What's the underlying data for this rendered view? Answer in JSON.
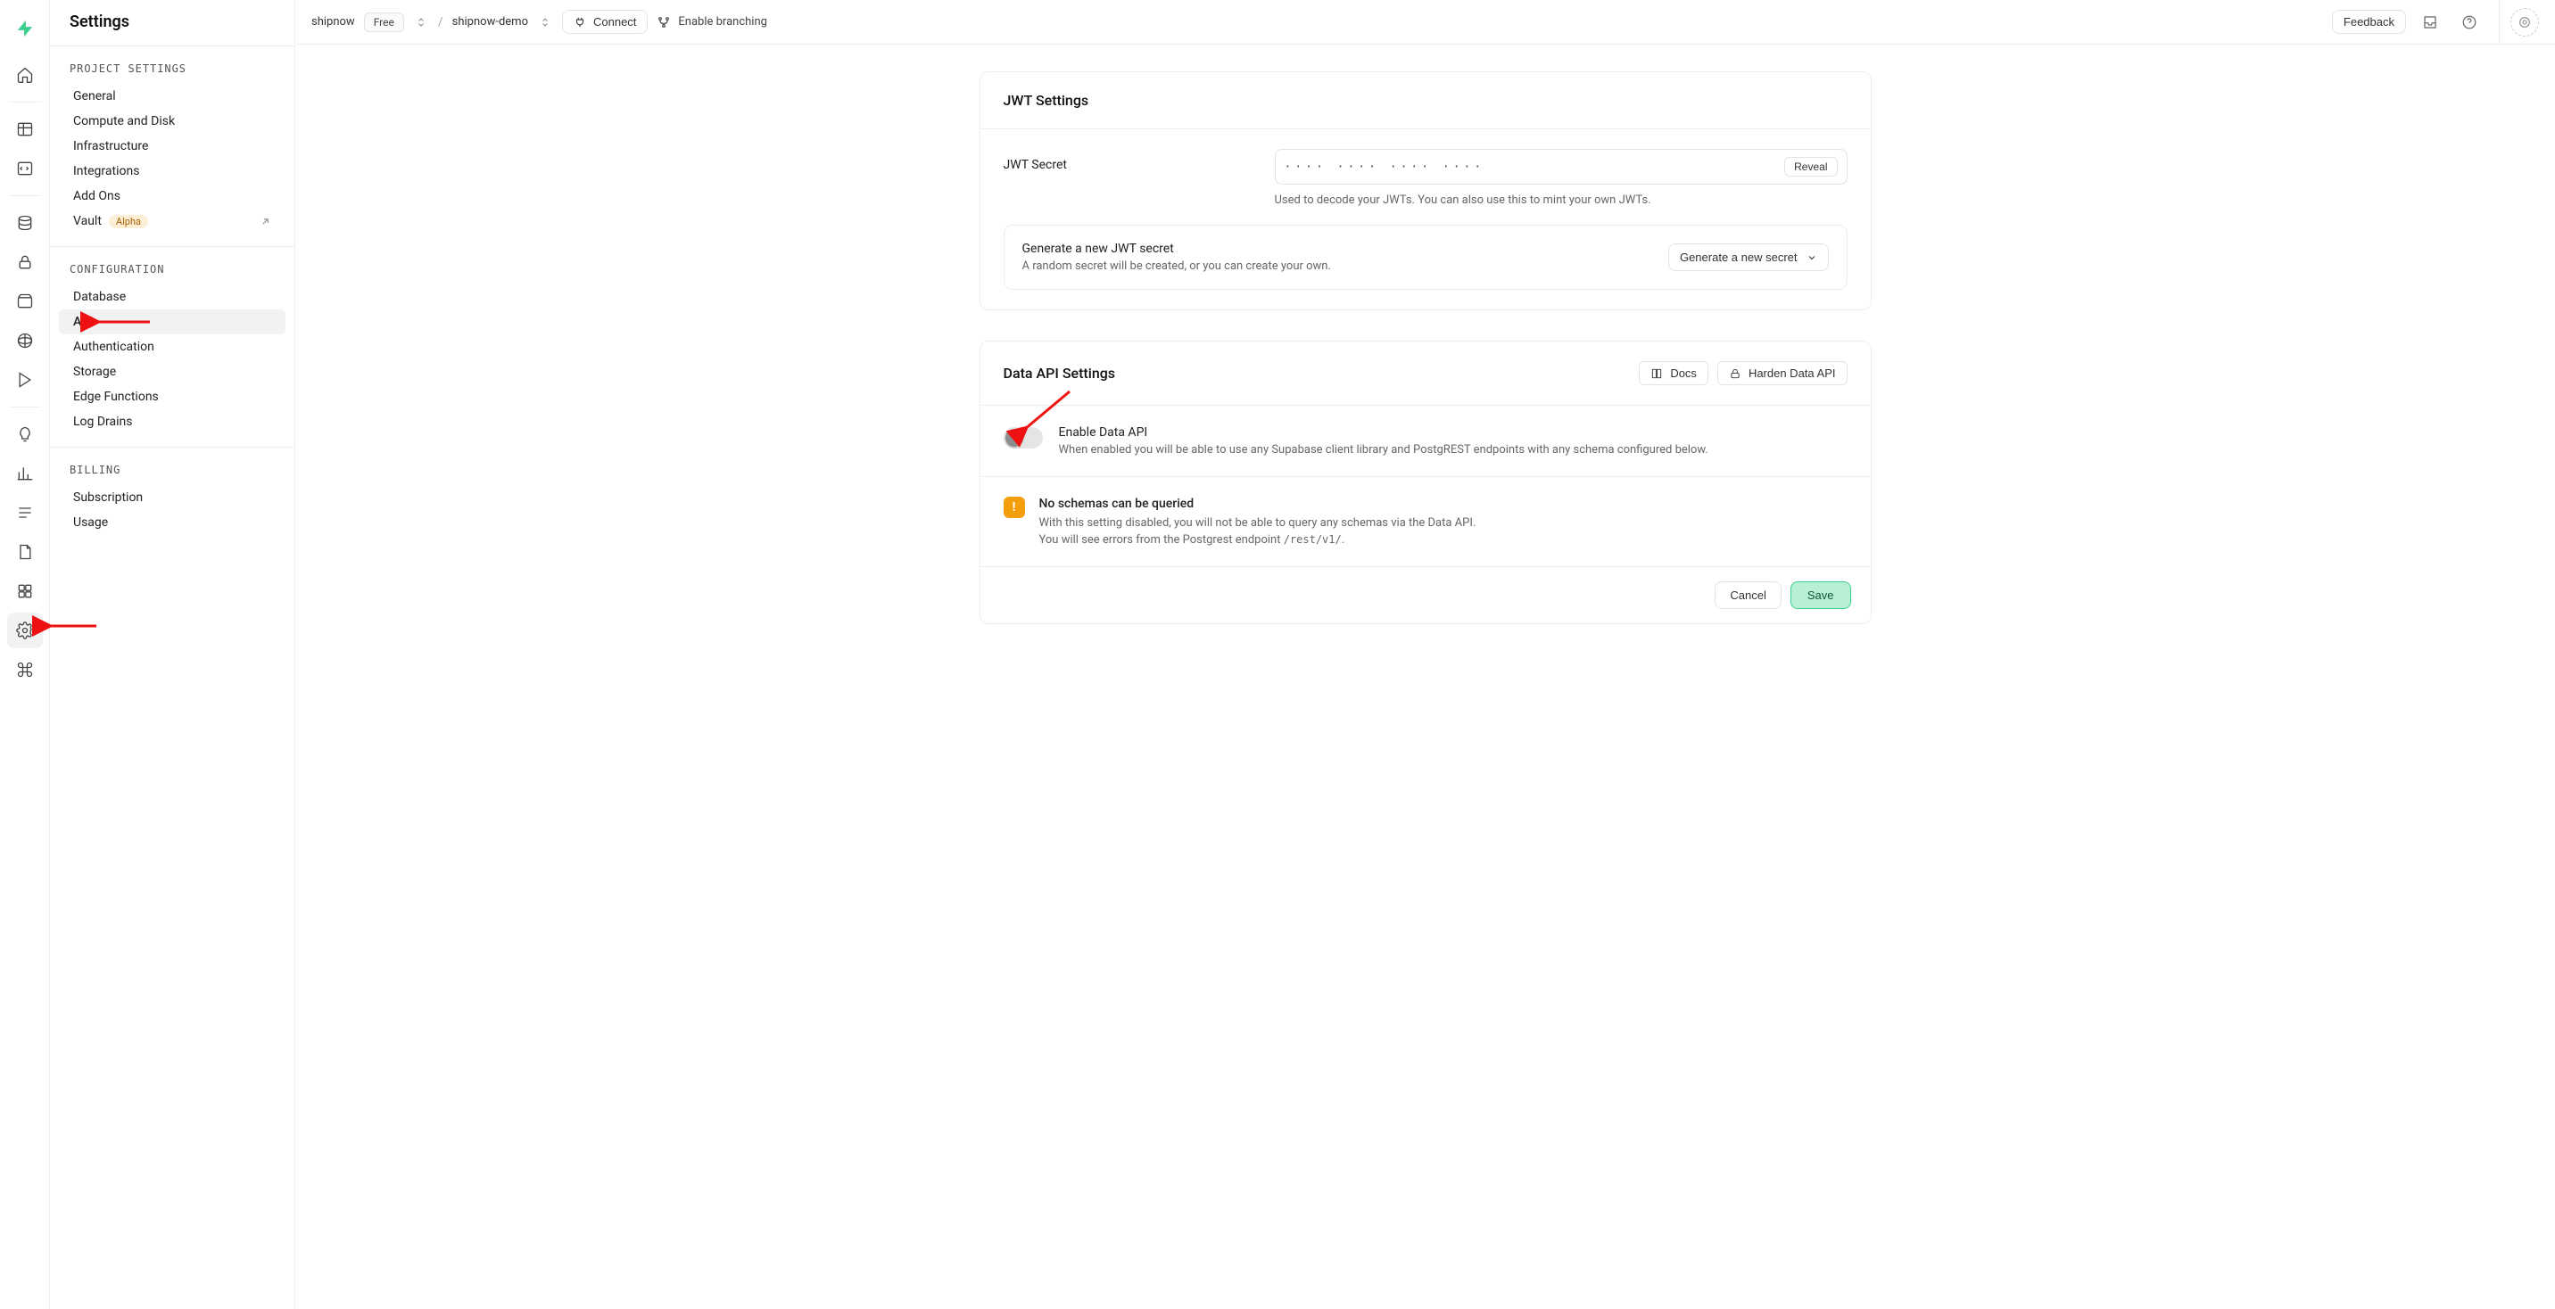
{
  "topbar": {
    "tenant": "shipnow",
    "plan": "Free",
    "project": "shipnow-demo",
    "connect": "Connect",
    "branching": "Enable branching",
    "feedback": "Feedback"
  },
  "sidebar": {
    "title": "Settings",
    "section_project": "PROJECT SETTINGS",
    "section_config": "CONFIGURATION",
    "section_billing": "BILLING",
    "items": {
      "general": "General",
      "compute": "Compute and Disk",
      "infra": "Infrastructure",
      "integrations": "Integrations",
      "addons": "Add Ons",
      "vault": "Vault",
      "vault_badge": "Alpha",
      "database": "Database",
      "api": "API",
      "auth": "Authentication",
      "storage": "Storage",
      "edge": "Edge Functions",
      "logs": "Log Drains",
      "subscription": "Subscription",
      "usage": "Usage"
    }
  },
  "jwt": {
    "title": "JWT Settings",
    "secret_label": "JWT Secret",
    "secret_mask": "···· ···· ···· ····",
    "reveal": "Reveal",
    "hint": "Used to decode your JWTs. You can also use this to mint your own JWTs.",
    "gen_title": "Generate a new JWT secret",
    "gen_sub": "A random secret will be created, or you can create your own.",
    "gen_btn": "Generate a new secret"
  },
  "dataapi": {
    "title": "Data API Settings",
    "docs": "Docs",
    "harden": "Harden Data API",
    "toggle_title": "Enable Data API",
    "toggle_sub": "When enabled you will be able to use any Supabase client library and PostgREST endpoints with any schema configured below.",
    "warn_title": "No schemas can be queried",
    "warn_l1": "With this setting disabled, you will not be able to query any schemas via the Data API.",
    "warn_l2a": "You will see errors from the Postgrest endpoint ",
    "warn_l2b": "/rest/v1/",
    "warn_l2c": ".",
    "cancel": "Cancel",
    "save": "Save"
  }
}
